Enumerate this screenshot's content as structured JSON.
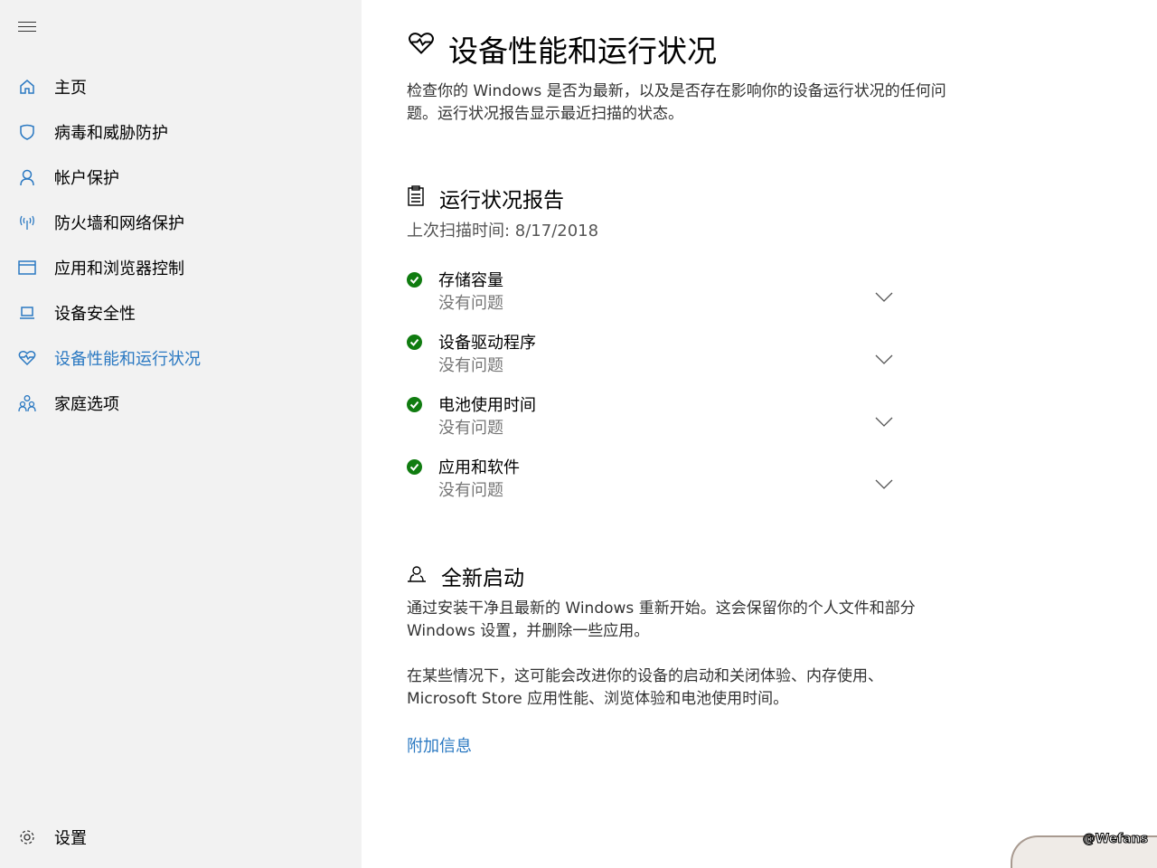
{
  "sidebar": {
    "items": [
      {
        "label": "主页",
        "icon": "home-icon"
      },
      {
        "label": "病毒和威胁防护",
        "icon": "shield-icon"
      },
      {
        "label": "帐户保护",
        "icon": "person-icon"
      },
      {
        "label": "防火墙和网络保护",
        "icon": "antenna-icon"
      },
      {
        "label": "应用和浏览器控制",
        "icon": "browser-window-icon"
      },
      {
        "label": "设备安全性",
        "icon": "laptop-icon"
      },
      {
        "label": "设备性能和运行状况",
        "icon": "heart-pulse-icon",
        "active": true
      },
      {
        "label": "家庭选项",
        "icon": "family-icon"
      }
    ],
    "settings_label": "设置"
  },
  "main": {
    "title": "设备性能和运行状况",
    "description": "检查你的 Windows 是否为最新，以及是否存在影响你的设备运行状况的任何问题。运行状况报告显示最近扫描的状态。",
    "report": {
      "title": "运行状况报告",
      "last_scan": "上次扫描时间: 8/17/2018",
      "items": [
        {
          "title": "存储容量",
          "status": "没有问题"
        },
        {
          "title": "设备驱动程序",
          "status": "没有问题"
        },
        {
          "title": "电池使用时间",
          "status": "没有问题"
        },
        {
          "title": "应用和软件",
          "status": "没有问题"
        }
      ]
    },
    "fresh_start": {
      "title": "全新启动",
      "p1": "通过安装干净且最新的 Windows 重新开始。这会保留你的个人文件和部分 Windows 设置，并删除一些应用。",
      "p2": "在某些情况下，这可能会改进你的设备的启动和关闭体验、内存使用、Microsoft Store 应用性能、浏览体验和电池使用时间。",
      "link": "附加信息"
    }
  },
  "watermark": "@Wefans",
  "colors": {
    "accent": "#2b79c2",
    "ok": "#107c10",
    "sidebar_bg": "#f2f2f2"
  }
}
